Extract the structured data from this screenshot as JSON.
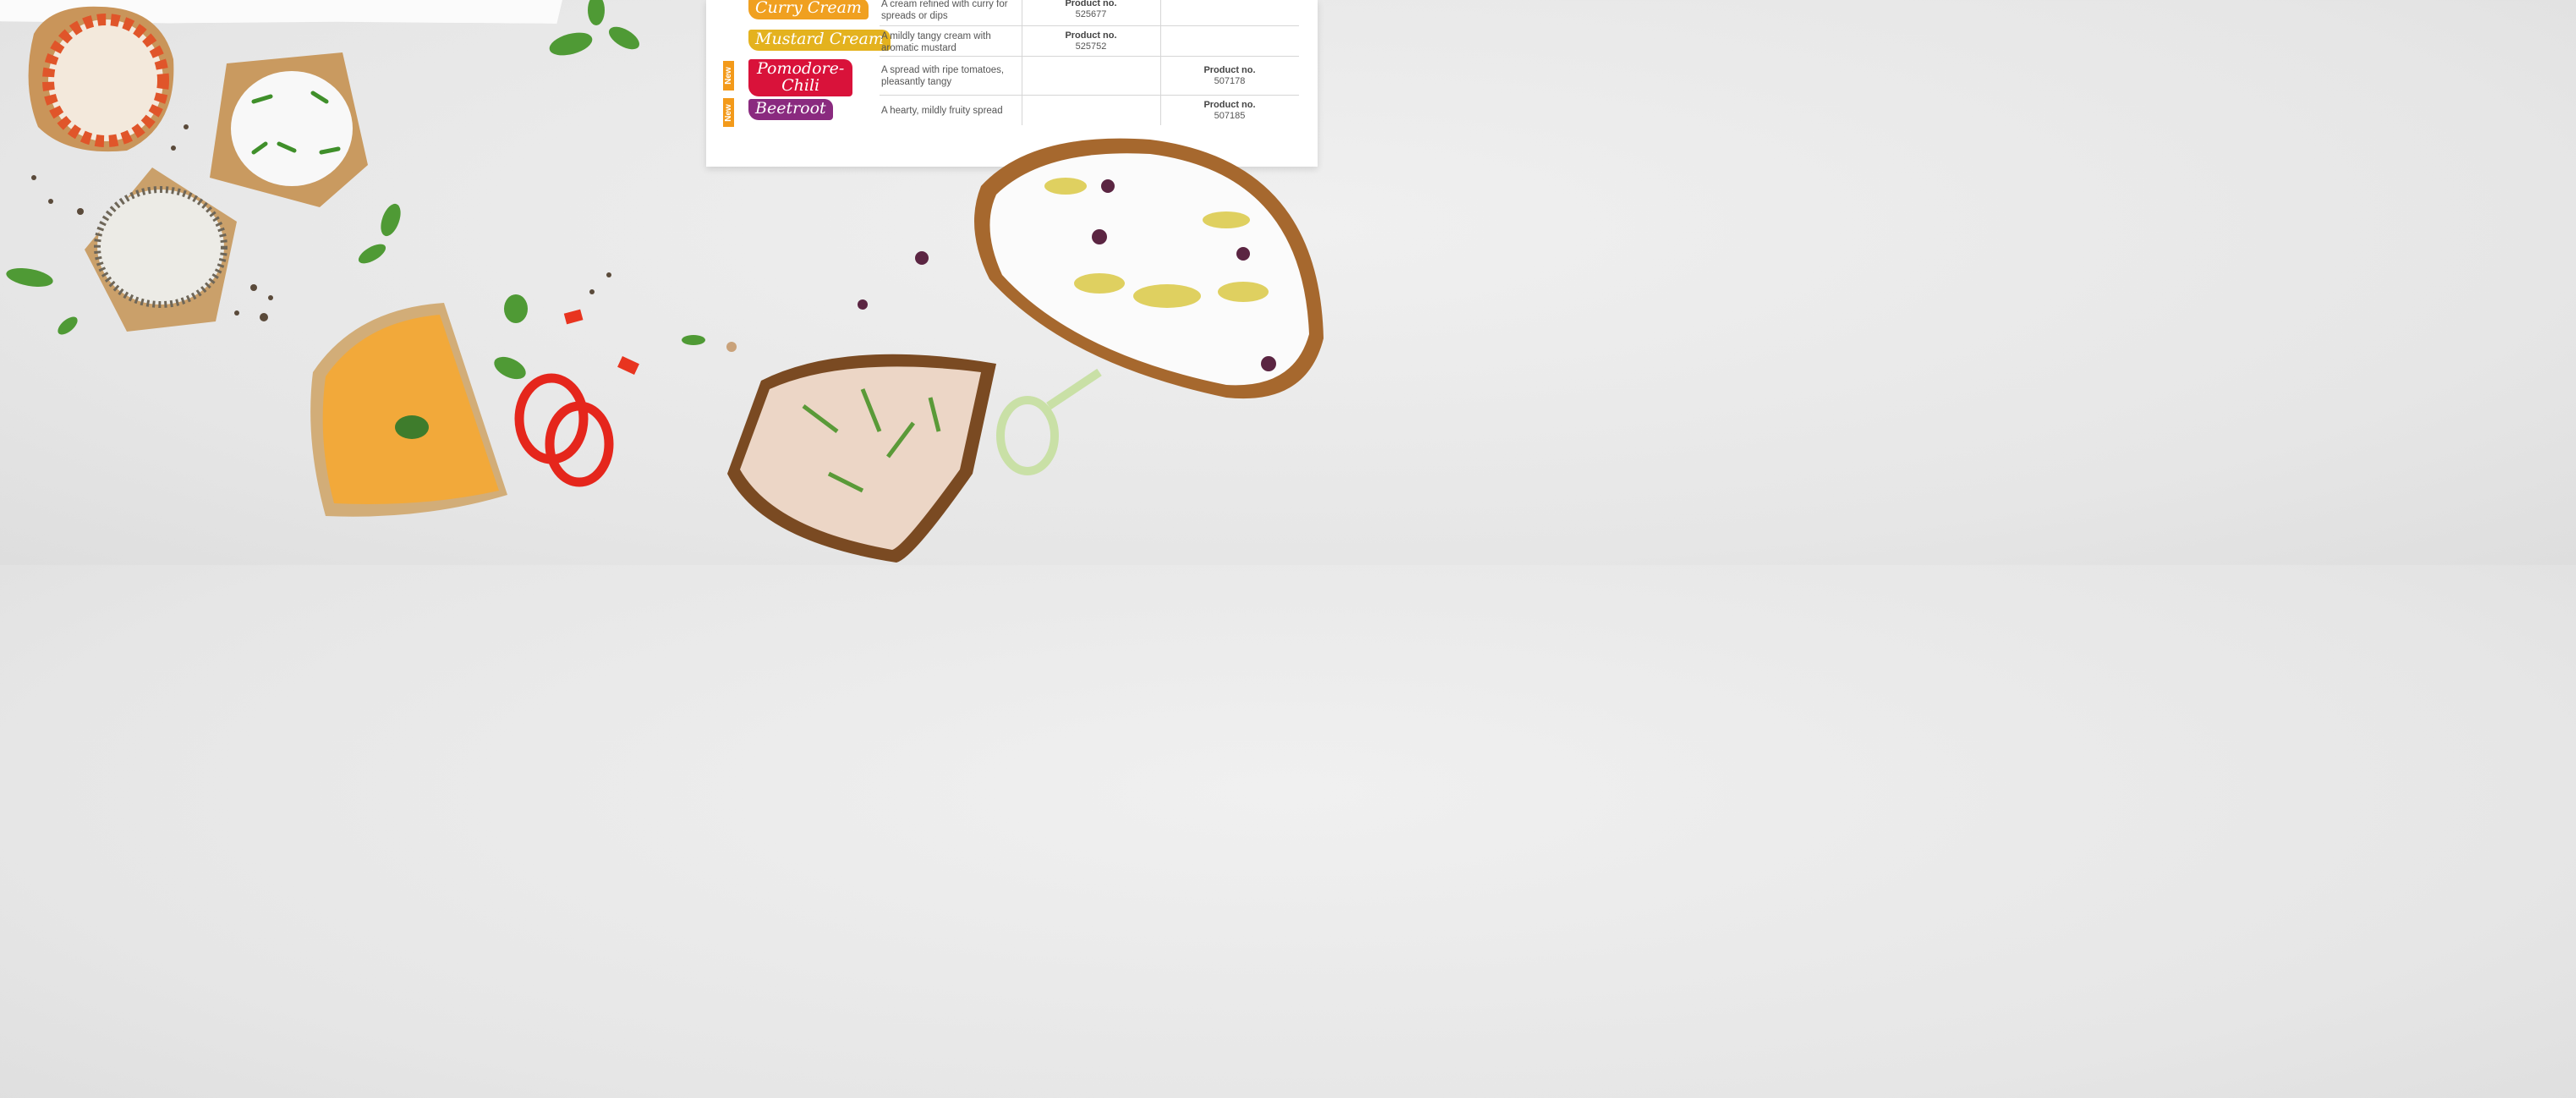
{
  "products": [
    {
      "name": "Curry Cream",
      "color": "#f0a020",
      "description": "A cream refined with curry for spreads or dips",
      "product_label": "Product no.",
      "product_no": "525677",
      "column": 1,
      "is_new": false
    },
    {
      "name": "Mustard Cream",
      "color": "#e4b21e",
      "description": "A mildly tangy cream with aromatic mustard",
      "product_label": "Product no.",
      "product_no": "525752",
      "column": 1,
      "is_new": false
    },
    {
      "name": "Pomodore-Chili",
      "name_line1": "Pomodore-",
      "name_line2": "Chili",
      "color": "#d9123a",
      "description": "A spread with ripe tomatoes, pleasantly tangy",
      "product_label": "Product no.",
      "product_no": "507178",
      "column": 2,
      "is_new": true
    },
    {
      "name": "Beetroot",
      "color": "#8a2a7f",
      "description": "A hearty, mildly fruity spread",
      "product_label": "Product no.",
      "product_no": "507185",
      "column": 2,
      "is_new": true
    }
  ],
  "new_badge": "New",
  "colors": {
    "badge": "#f39a1a",
    "paper": "#ffffff",
    "background": "#e9e9e9"
  }
}
